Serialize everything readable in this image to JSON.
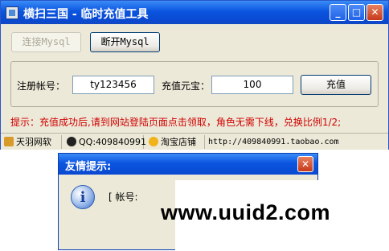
{
  "window": {
    "title": "横扫三国 - 临时充值工具",
    "controls": {
      "minimize": "_",
      "maximize": "□",
      "close": "✕"
    }
  },
  "toolbar": {
    "connect_label": "连接Mysql",
    "disconnect_label": "断开Mysql"
  },
  "form": {
    "account_label": "注册帐号：",
    "account_value": "ty123456",
    "amount_label": "充值元宝：",
    "amount_value": "100",
    "submit_label": "充值"
  },
  "notice": "提示：充值成功后,请到网站登陆页面点击领取，角色无需下线，兑换比例1/2;",
  "statusbar": {
    "studio": "天羽网软",
    "qq": "QQ:409840991",
    "shop_label": "淘宝店铺",
    "shop_url": "http://409840991.taobao.com"
  },
  "dialog": {
    "title": "友情提示:",
    "message": "[ 帐号:",
    "close": "✕",
    "icon": "i"
  },
  "watermark": "www.uuid2.com"
}
